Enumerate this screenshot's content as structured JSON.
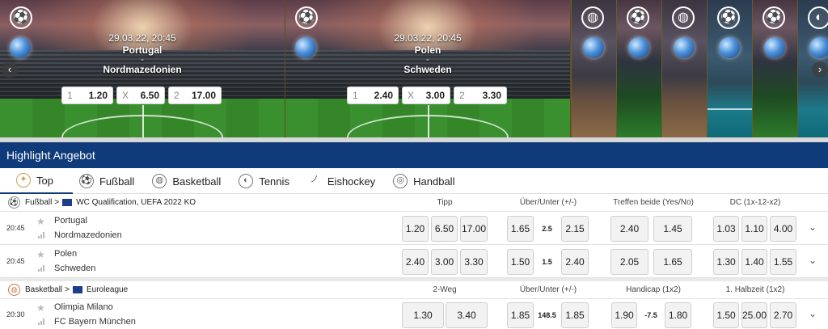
{
  "banner": {
    "matches": [
      {
        "datetime": "29.03.22, 20:45",
        "home": "Portugal",
        "dash": "-",
        "away": "Nordmazedonien",
        "odds": [
          {
            "label": "1",
            "value": "1.20"
          },
          {
            "label": "X",
            "value": "6.50"
          },
          {
            "label": "2",
            "value": "17.00"
          }
        ]
      },
      {
        "datetime": "29.03.22, 20:45",
        "home": "Polen",
        "dash": "-",
        "away": "Schweden",
        "odds": [
          {
            "label": "1",
            "value": "2.40"
          },
          {
            "label": "X",
            "value": "3.00"
          },
          {
            "label": "2",
            "value": "3.30"
          }
        ]
      }
    ],
    "mini_cards": [
      "basketball",
      "soccer",
      "basketball",
      "soccer",
      "soccer",
      "tennis"
    ]
  },
  "highlight": {
    "title": "Highlight Angebot"
  },
  "tabs": [
    {
      "label": "Top",
      "icon": "top-icon"
    },
    {
      "label": "Fußball",
      "icon": "soccer-icon"
    },
    {
      "label": "Basketball",
      "icon": "basketball-icon"
    },
    {
      "label": "Tennis",
      "icon": "tennis-icon"
    },
    {
      "label": "Eishockey",
      "icon": "hockey-icon"
    },
    {
      "label": "Handball",
      "icon": "handball-icon"
    }
  ],
  "sections": [
    {
      "sport": "Fußball",
      "sep": ">",
      "league": "WC Qualification, UEFA 2022 KO",
      "columns": [
        "Tipp",
        "Über/Unter (+/-)",
        "Treffen beide (Yes/No)",
        "DC (1x-12-x2)"
      ],
      "events": [
        {
          "time": "20:45",
          "home": "Portugal",
          "away": "Nordmazedonien",
          "tipp": [
            "1.20",
            "6.50",
            "17.00"
          ],
          "ou": [
            "1.65",
            "2.15"
          ],
          "ou_line": "2.5",
          "third": [
            "2.40",
            "1.45"
          ],
          "dc": [
            "1.03",
            "1.10",
            "4.00"
          ]
        },
        {
          "time": "20:45",
          "home": "Polen",
          "away": "Schweden",
          "tipp": [
            "2.40",
            "3.00",
            "3.30"
          ],
          "ou": [
            "1.50",
            "2.40"
          ],
          "ou_line": "1.5",
          "third": [
            "2.05",
            "1.65"
          ],
          "dc": [
            "1.30",
            "1.40",
            "1.55"
          ]
        }
      ]
    },
    {
      "sport": "Basketball",
      "sep": ">",
      "league": "Euroleague",
      "columns": [
        "2-Weg",
        "Über/Unter (+/-)",
        "Handicap (1x2)",
        "1. Halbzeit (1x2)"
      ],
      "events": [
        {
          "time": "20:30",
          "home": "Olimpia Milano",
          "away": "FC Bayern München",
          "tipp": [
            "1.30",
            "3.40"
          ],
          "ou": [
            "1.85",
            "1.85"
          ],
          "ou_line": "148.5",
          "third": [
            "1.90",
            "1.80"
          ],
          "third_line": "-7.5",
          "dc": [
            "1.50",
            "25.00",
            "2.70"
          ]
        }
      ]
    }
  ]
}
